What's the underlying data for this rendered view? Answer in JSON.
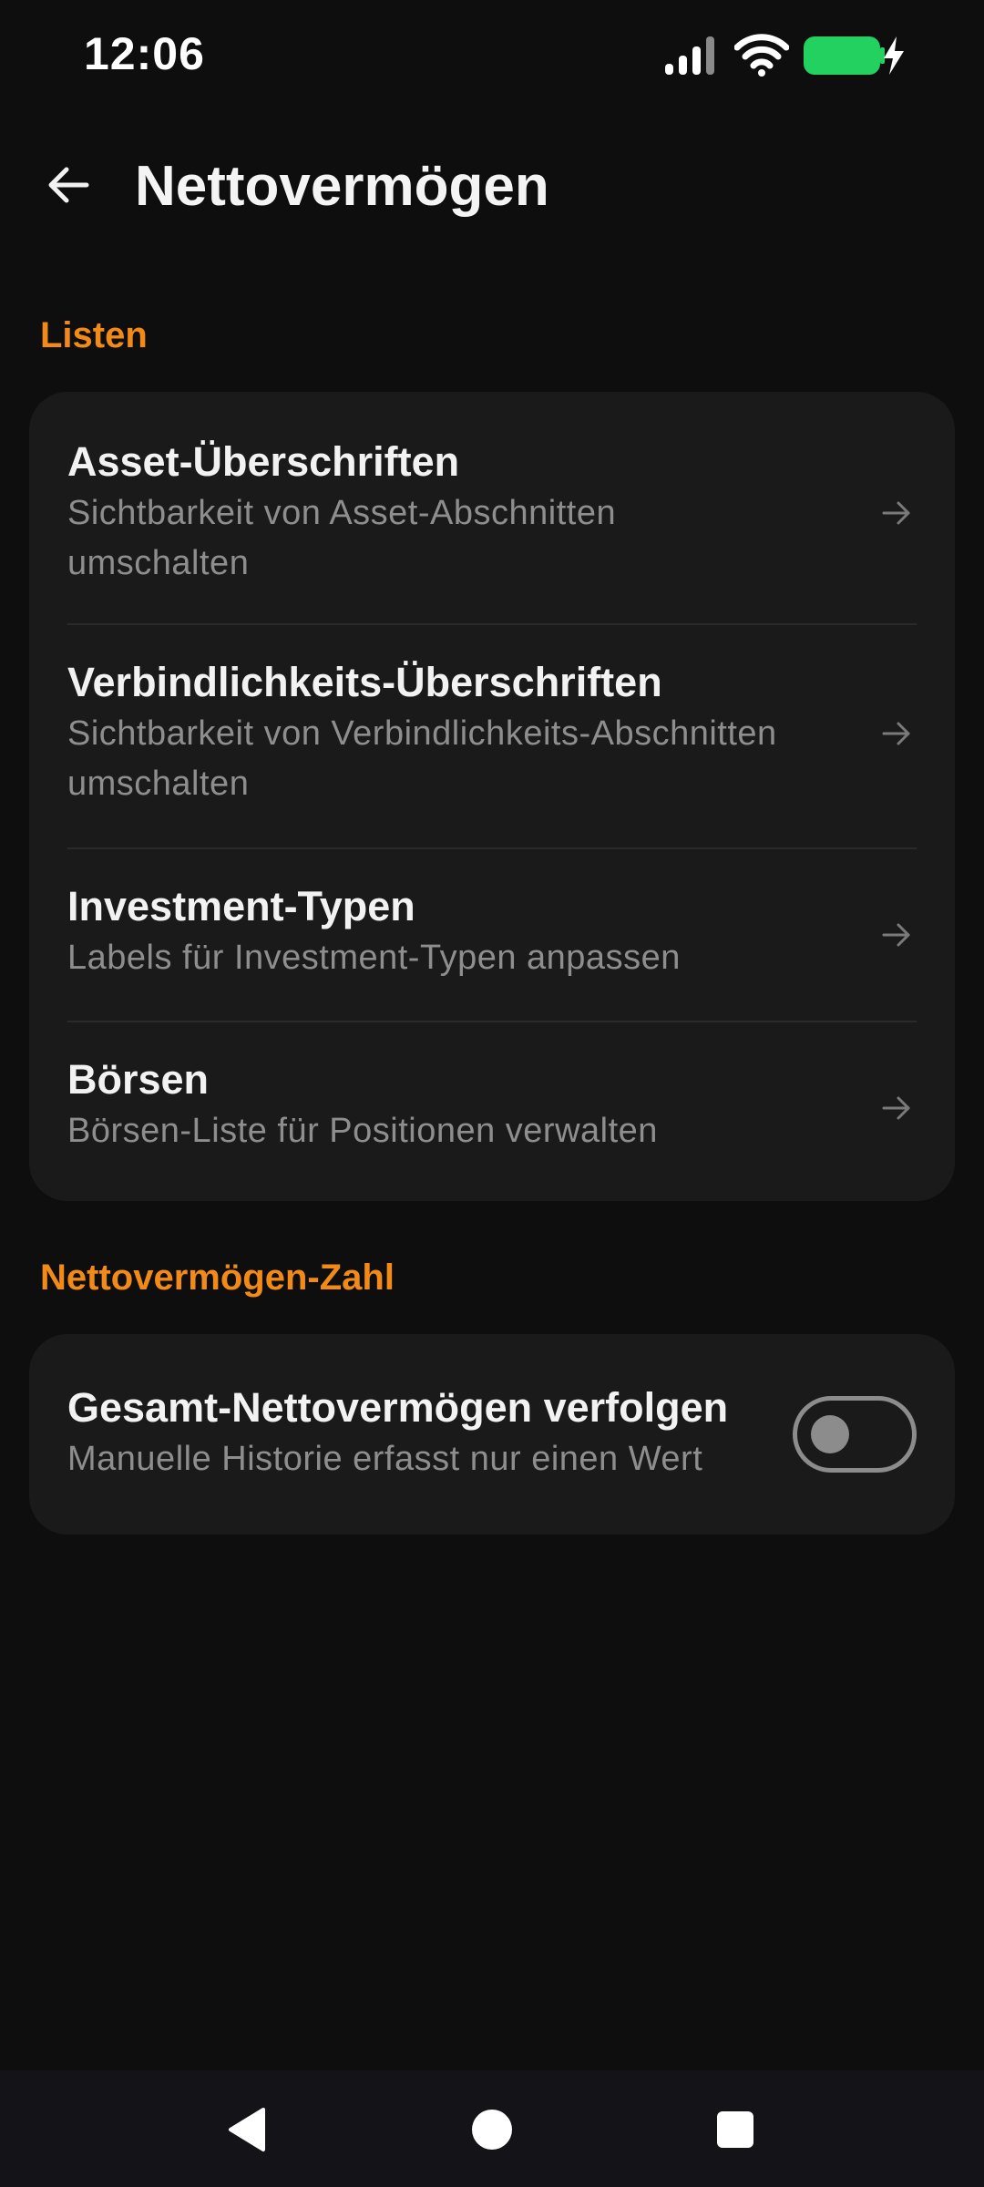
{
  "status_bar": {
    "time": "12:06",
    "icons": [
      "signal-icon",
      "wifi-icon",
      "battery-charging-icon"
    ],
    "battery_color": "#23d160"
  },
  "app_bar": {
    "title": "Nettovermögen",
    "back_icon": "arrow-left-icon"
  },
  "sections": {
    "lists": {
      "header": "Listen",
      "items": [
        {
          "title": "Asset-Überschriften",
          "subtitle_line1": "Sichtbarkeit von Asset-Abschnitten",
          "subtitle_line2": "umschalten"
        },
        {
          "title": "Verbindlichkeits-Überschriften",
          "subtitle_line1": "Sichtbarkeit von Verbindlichkeits-Abschnitten",
          "subtitle_line2": "umschalten"
        },
        {
          "title": "Investment-Typen",
          "subtitle_line1": "Labels für Investment-Typen anpassen"
        },
        {
          "title": "Börsen",
          "subtitle_line1": "Börsen-Liste für Positionen verwalten"
        }
      ]
    },
    "net_worth": {
      "header": "Nettovermögen-Zahl",
      "toggle_item": {
        "title": "Gesamt-Nettovermögen verfolgen",
        "subtitle": "Manuelle Historie erfasst nur einen Wert",
        "enabled": false
      }
    }
  },
  "nav_bar": {
    "buttons": [
      "back-triangle-icon",
      "home-circle-icon",
      "recents-square-icon"
    ]
  },
  "colors": {
    "accent": "#f18a17",
    "background": "#0e0e0e",
    "card": "#1a1a1b"
  }
}
